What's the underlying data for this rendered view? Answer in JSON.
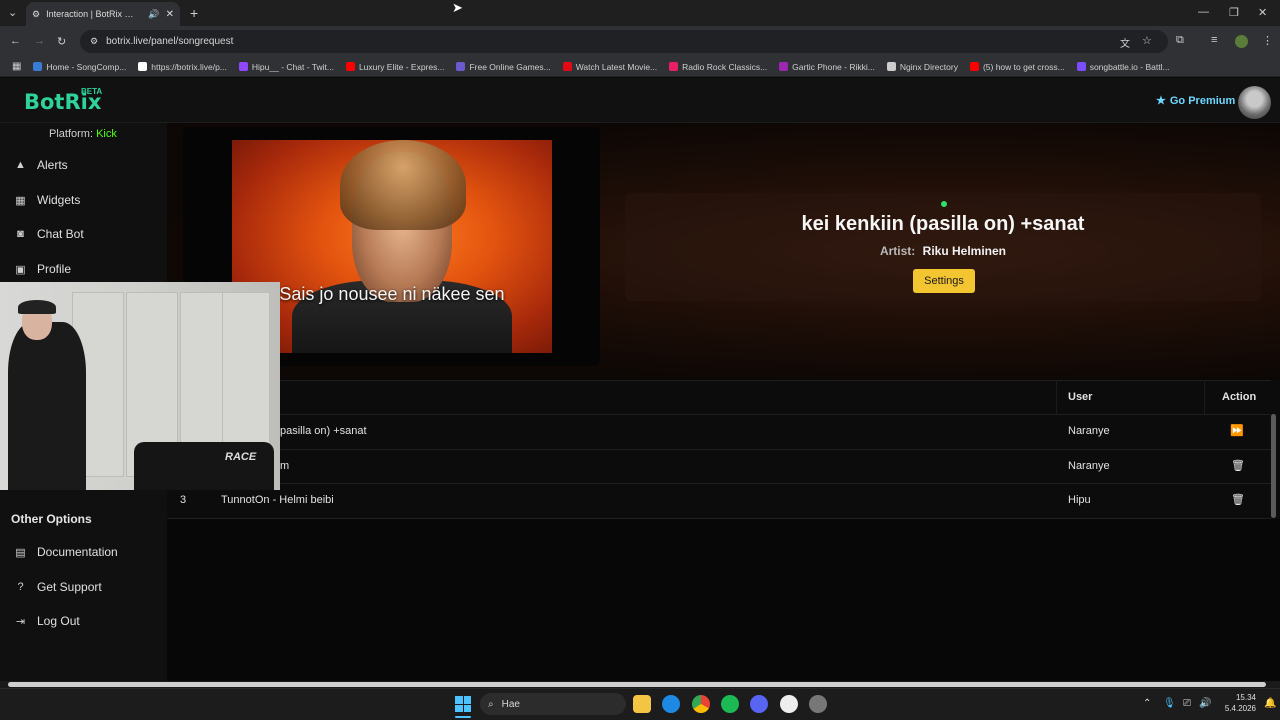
{
  "browser": {
    "tab_title": "Interaction | BotRix — Cloud",
    "new_tab": "+",
    "url": "botrix.live/panel/songrequest",
    "window_controls": [
      "—",
      "❐",
      "✕"
    ],
    "bookmarks": [
      {
        "label": "Home - SongComp...",
        "color": "#3a7bd5"
      },
      {
        "label": "https://botrix.live/p...",
        "color": "#ffffff"
      },
      {
        "label": "Hipu__ - Chat - Twit...",
        "color": "#9146ff"
      },
      {
        "label": "Luxury Elite - Expres...",
        "color": "#ff0000"
      },
      {
        "label": "Free Online Games...",
        "color": "#6a5acd"
      },
      {
        "label": "Watch Latest Movie...",
        "color": "#e50914"
      },
      {
        "label": "Radio Rock Classics...",
        "color": "#e91e63"
      },
      {
        "label": "Gartic Phone - Rikki...",
        "color": "#9c27b0"
      },
      {
        "label": "Nginx Directory",
        "color": "#cccccc"
      },
      {
        "label": "(5) how to get cross...",
        "color": "#ff0000"
      },
      {
        "label": "songbattle.io - Battl...",
        "color": "#7c4dff"
      }
    ]
  },
  "header": {
    "logo": "BotRix",
    "beta": "BETA",
    "premium": "Go Premium"
  },
  "sidebar": {
    "platform_label": "Platform:",
    "platform_value": "Kick",
    "items": [
      {
        "label": "Alerts",
        "icon": "warning-icon"
      },
      {
        "label": "Widgets",
        "icon": "grid-icon"
      },
      {
        "label": "Chat Bot",
        "icon": "robot-icon"
      },
      {
        "label": "Profile",
        "icon": "profile-icon"
      }
    ],
    "other_title": "Other Options",
    "other_items": [
      {
        "label": "Documentation",
        "icon": "document-icon"
      },
      {
        "label": "Get Support",
        "icon": "help-icon"
      },
      {
        "label": "Log Out",
        "icon": "logout-icon"
      }
    ]
  },
  "now_playing": {
    "lyrics": "Sais jo nousee ni näkee sen",
    "title": "kei kenkiin (pasilla on) +sanat",
    "artist_label": "Artist:",
    "artist": "Riku Helminen",
    "settings": "Settings"
  },
  "queue": {
    "columns": {
      "user": "User",
      "action": "Action"
    },
    "rows": [
      {
        "num": "",
        "title": "pasilla on) +sanat",
        "user": "Naranye",
        "action": "skip-icon"
      },
      {
        "num": "",
        "title": "m",
        "user": "Naranye",
        "action": "trash-icon"
      },
      {
        "num": "3",
        "title": "TunnotOn - Helmi beibi",
        "user": "Hipu",
        "action": "trash-icon"
      }
    ]
  },
  "webcam": {
    "chair_logo": "RACE"
  },
  "taskbar": {
    "search": "Hae",
    "time": "15.34",
    "date": "5.4.2026"
  }
}
